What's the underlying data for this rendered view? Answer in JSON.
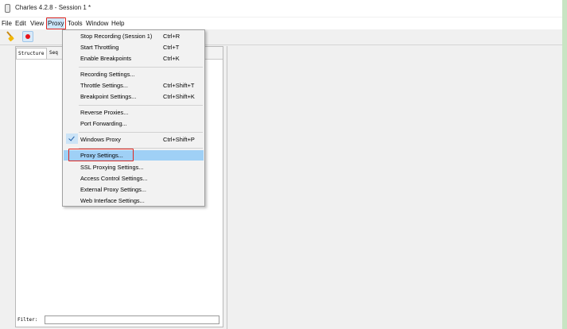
{
  "window": {
    "title": "Charles 4.2.8 - Session 1 *"
  },
  "menubar": [
    "File",
    "Edit",
    "View",
    "Proxy",
    "Tools",
    "Window",
    "Help"
  ],
  "toolbar": {
    "icons": [
      "broom-icon",
      "record-icon"
    ]
  },
  "left_panel": {
    "tabs": [
      "Structure",
      "Seq"
    ],
    "filter_label": "Filter:",
    "filter_value": ""
  },
  "proxy_menu": {
    "items": [
      {
        "label": "Stop Recording (Session 1)",
        "shortcut": "Ctrl+R"
      },
      {
        "label": "Start Throttling",
        "shortcut": "Ctrl+T"
      },
      {
        "label": "Enable Breakpoints",
        "shortcut": "Ctrl+K"
      },
      {
        "label": "Recording Settings...",
        "shortcut": ""
      },
      {
        "label": "Throttle Settings...",
        "shortcut": "Ctrl+Shift+T"
      },
      {
        "label": "Breakpoint Settings...",
        "shortcut": "Ctrl+Shift+K"
      },
      {
        "label": "Reverse Proxies...",
        "shortcut": ""
      },
      {
        "label": "Port Forwarding...",
        "shortcut": ""
      },
      {
        "label": "Windows Proxy",
        "shortcut": "Ctrl+Shift+P",
        "checked": true
      },
      {
        "label": "Proxy Settings...",
        "shortcut": "",
        "selected": true
      },
      {
        "label": "SSL Proxying Settings...",
        "shortcut": ""
      },
      {
        "label": "Access Control Settings...",
        "shortcut": ""
      },
      {
        "label": "External Proxy Settings...",
        "shortcut": ""
      },
      {
        "label": "Web Interface Settings...",
        "shortcut": ""
      }
    ]
  },
  "colors": {
    "highlight": "#e0251f",
    "selected": "#9fd0f6",
    "record": "#e8121a"
  }
}
